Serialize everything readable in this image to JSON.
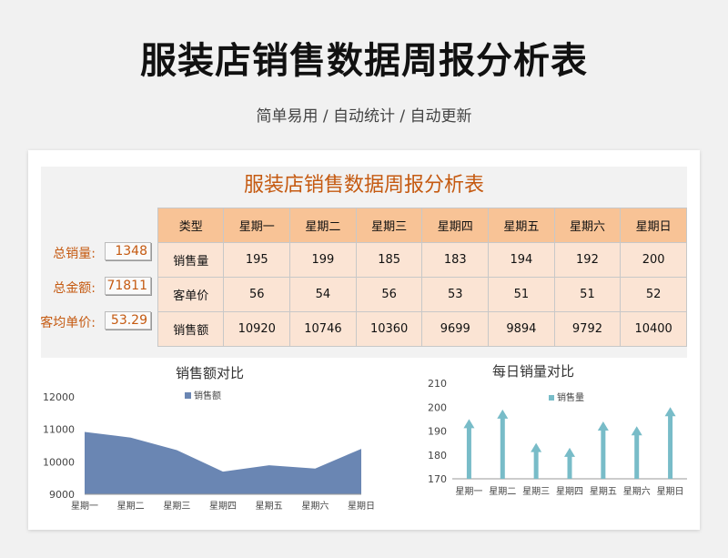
{
  "header": {
    "title": "服装店销售数据周报分析表",
    "subtitle": "简单易用 / 自动统计 / 自动更新"
  },
  "sheet": {
    "title": "服装店销售数据周报分析表",
    "summary": [
      {
        "label": "总销量:",
        "value": "1348"
      },
      {
        "label": "总金额:",
        "value": "71811"
      },
      {
        "label": "客均单价:",
        "value": "53.29"
      }
    ],
    "table": {
      "header": [
        "类型",
        "星期一",
        "星期二",
        "星期三",
        "星期四",
        "星期五",
        "星期六",
        "星期日"
      ],
      "rows": [
        [
          "销售量",
          "195",
          "199",
          "185",
          "183",
          "194",
          "192",
          "200"
        ],
        [
          "客单价",
          "56",
          "54",
          "56",
          "53",
          "51",
          "51",
          "52"
        ],
        [
          "销售额",
          "10920",
          "10746",
          "10360",
          "9699",
          "9894",
          "9792",
          "10400"
        ]
      ]
    }
  },
  "chart_data": [
    {
      "type": "area",
      "title": "销售额对比",
      "categories": [
        "星期一",
        "星期二",
        "星期三",
        "星期四",
        "星期五",
        "星期六",
        "星期日"
      ],
      "series": [
        {
          "name": "销售额",
          "values": [
            10920,
            10746,
            10360,
            9699,
            9894,
            9792,
            10400
          ]
        }
      ],
      "yticks": [
        "9000",
        "10000",
        "11000",
        "12000"
      ],
      "ylim": [
        9000,
        12000
      ],
      "legend": "top",
      "grid": false,
      "color": "#6a86b3"
    },
    {
      "type": "bar",
      "title": "每日销量对比",
      "categories": [
        "星期一",
        "星期二",
        "星期三",
        "星期四",
        "星期五",
        "星期六",
        "星期日"
      ],
      "series": [
        {
          "name": "销售量",
          "values": [
            195,
            199,
            185,
            183,
            194,
            192,
            200
          ]
        }
      ],
      "yticks": [
        "170",
        "180",
        "190",
        "200",
        "210"
      ],
      "ylim": [
        170,
        210
      ],
      "legend": "top",
      "grid": false,
      "color": "#78bcc8"
    }
  ]
}
